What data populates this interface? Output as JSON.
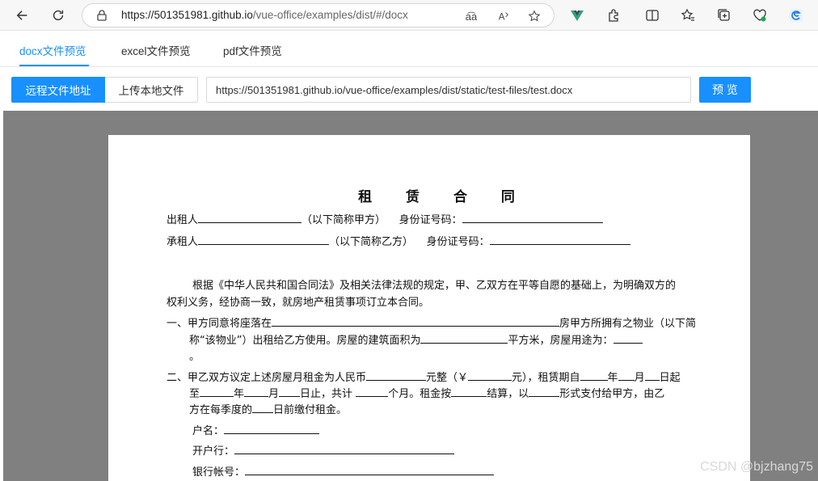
{
  "browser": {
    "url_host": "https://501351981.github.io",
    "url_path": "/vue-office/examples/dist/#/docx",
    "read_aloud_icon": "a͡a"
  },
  "tabs": [
    {
      "label": "docx文件预览"
    },
    {
      "label": "excel文件预览"
    },
    {
      "label": "pdf文件预览"
    }
  ],
  "toolbar": {
    "remote_label": "远程文件地址",
    "upload_label": "上传本地文件",
    "url_value": "https://501351981.github.io/vue-office/examples/dist/static/test-files/test.docx",
    "preview_label": "预 览"
  },
  "document": {
    "title": "租 赁 合 同",
    "lessor_a": "出租人",
    "lessor_b": "（以下简称甲方）",
    "lessor_c": "身份证号码：",
    "lessee_a": "承租人",
    "lessee_b": "（以下简称乙方）",
    "lessee_c": "身份证号码：",
    "para1_l1": "根据《中华人民共和国合同法》及相关法律法规的规定，甲、乙双方在平等自愿的基础上，为明确双方的",
    "para1_l2": "权利义务，经协商一致，就房地产租赁事项订立本合同。",
    "item1_a": "一、甲方同意将座落在",
    "item1_b": "房甲方所拥有之物业（以下简",
    "item1_c": "称“该物业”）出租给乙方使用。房屋的建筑面积为",
    "item1_d": "平方米，房屋用途为：",
    "item1_e": "。",
    "item2_a": "二、甲乙双方议定上述房屋月租金为人民币",
    "item2_b": "元整（￥",
    "item2_c": "元），租赁期自",
    "item2_d": "年",
    "item2_e": "月",
    "item2_f": "日起",
    "item2_g": "至",
    "item2_h": "年",
    "item2_i": "月",
    "item2_j": "日止，共计",
    "item2_k": "个月。租金按",
    "item2_l": "结算，以",
    "item2_m": "形式支付给甲方，由乙",
    "item2_n": "方在每季度的",
    "item2_o": "日前缴付租金。",
    "account_name": "户名：",
    "bank": "开户行：",
    "account_no": "银行帐号："
  },
  "watermark": "CSDN @bjzhang75",
  "colors": {
    "accent": "#1890ff",
    "viewer_bg": "#808080"
  }
}
